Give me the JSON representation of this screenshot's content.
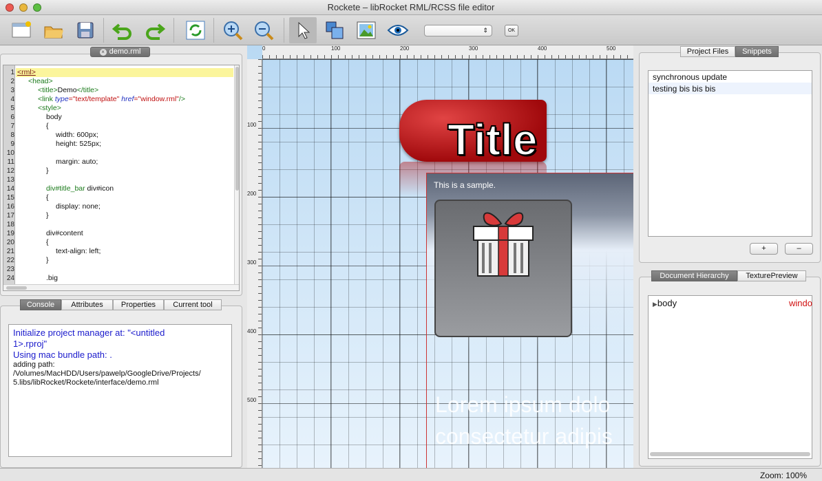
{
  "window": {
    "title": "Rockete – libRocket RML/RCSS file editor"
  },
  "toolbar": {
    "buttons": [
      "new-file-icon",
      "open-folder-icon",
      "save-icon",
      "undo-icon",
      "redo-icon",
      "reload-icon",
      "zoom-in-icon",
      "zoom-out-icon",
      "select-arrow-icon",
      "move-layers-icon",
      "image-icon",
      "eye-icon"
    ],
    "combo_value": "",
    "combo_arrow": "⇕",
    "ok_label": "OK"
  },
  "editor": {
    "tab_label": "demo.rml",
    "line_numbers": [
      "1",
      "2",
      "3",
      "4",
      "5",
      "6",
      "7",
      "8",
      "9",
      "10",
      "11",
      "12",
      "13",
      "14",
      "15",
      "16",
      "17",
      "18",
      "19",
      "20",
      "21",
      "22",
      "23",
      "24"
    ],
    "lines": {
      "l1_tag": "<rml>",
      "l2": "<head>",
      "l3_open": "<title>",
      "l3_text": "Demo",
      "l3_close": "</title>",
      "l4_tag": "<link ",
      "l4_attr1": "type",
      "l4_val1": "=\"text/template\" ",
      "l4_attr2": "href",
      "l4_val2": "=\"window.rml\"",
      "l4_end": "/>",
      "l5": "<style>",
      "l6": "body",
      "l7": "{",
      "l8": "width: 600px;",
      "l9": "height: 525px;",
      "l11": "margin: auto;",
      "l12": "}",
      "l14_sel": "div#title_bar",
      "l14_rest": " div#icon",
      "l15": "{",
      "l16": "display: none;",
      "l17": "}",
      "l19": "div#content",
      "l20": "{",
      "l21": "text-align: left;",
      "l22": "}",
      "l24": ".big"
    }
  },
  "bottom_tabs": [
    "Console",
    "Attributes",
    "Properties",
    "Current tool"
  ],
  "console": {
    "lines_blue": [
      "Initialize project manager at:  \"<untitled",
      "1>.rproj\"",
      "Using mac bundle path:  ."
    ],
    "lines_black": [
      "adding path:",
      "/Volumes/MacHDD/Users/pawelp/GoogleDrive/Projects/",
      "5.libs/libRocket/Rockete/interface/demo.rml"
    ]
  },
  "canvas": {
    "ruler_h": [
      "0",
      "100",
      "200",
      "300",
      "400",
      "500"
    ],
    "ruler_v": [
      "100",
      "200",
      "300",
      "400",
      "500"
    ],
    "title_text": "Title",
    "sample_text": "This is a sample.",
    "lorem_1": "Lorem ipsum dolo",
    "lorem_2": "consectetur adipis"
  },
  "right_top_tabs": [
    "Project Files",
    "Snippets"
  ],
  "snippets": [
    "synchronous update",
    "testing bis bis bis"
  ],
  "snippet_buttons": {
    "add": "+",
    "remove": "–"
  },
  "right_bottom_tabs": [
    "Document Hierarchy",
    "TexturePreview"
  ],
  "hierarchy": {
    "node": "body",
    "value": "windo"
  },
  "status": {
    "zoom": "Zoom: 100%"
  },
  "colors": {
    "accent_tab": "#6e6e6e",
    "title_red": "#b51a1a",
    "link_blue": "#1a1acc"
  }
}
